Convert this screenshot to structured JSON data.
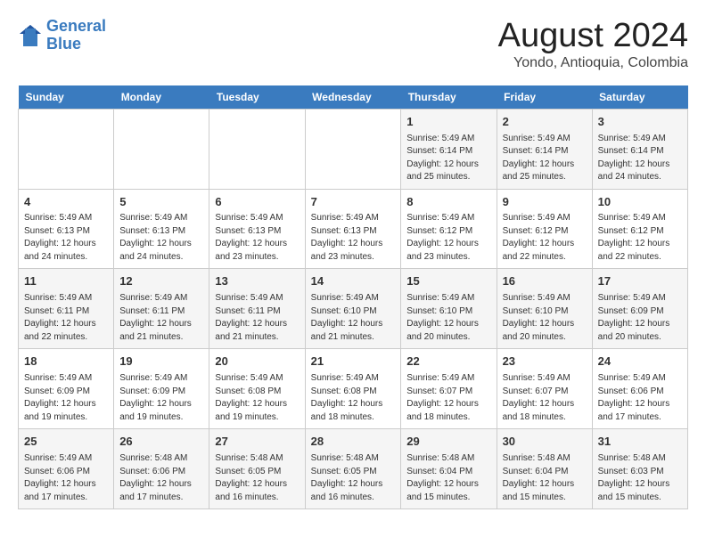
{
  "header": {
    "logo_line1": "General",
    "logo_line2": "Blue",
    "month_year": "August 2024",
    "location": "Yondo, Antioquia, Colombia"
  },
  "days_of_week": [
    "Sunday",
    "Monday",
    "Tuesday",
    "Wednesday",
    "Thursday",
    "Friday",
    "Saturday"
  ],
  "weeks": [
    [
      {
        "num": "",
        "info": ""
      },
      {
        "num": "",
        "info": ""
      },
      {
        "num": "",
        "info": ""
      },
      {
        "num": "",
        "info": ""
      },
      {
        "num": "1",
        "info": "Sunrise: 5:49 AM\nSunset: 6:14 PM\nDaylight: 12 hours\nand 25 minutes."
      },
      {
        "num": "2",
        "info": "Sunrise: 5:49 AM\nSunset: 6:14 PM\nDaylight: 12 hours\nand 25 minutes."
      },
      {
        "num": "3",
        "info": "Sunrise: 5:49 AM\nSunset: 6:14 PM\nDaylight: 12 hours\nand 24 minutes."
      }
    ],
    [
      {
        "num": "4",
        "info": "Sunrise: 5:49 AM\nSunset: 6:13 PM\nDaylight: 12 hours\nand 24 minutes."
      },
      {
        "num": "5",
        "info": "Sunrise: 5:49 AM\nSunset: 6:13 PM\nDaylight: 12 hours\nand 24 minutes."
      },
      {
        "num": "6",
        "info": "Sunrise: 5:49 AM\nSunset: 6:13 PM\nDaylight: 12 hours\nand 23 minutes."
      },
      {
        "num": "7",
        "info": "Sunrise: 5:49 AM\nSunset: 6:13 PM\nDaylight: 12 hours\nand 23 minutes."
      },
      {
        "num": "8",
        "info": "Sunrise: 5:49 AM\nSunset: 6:12 PM\nDaylight: 12 hours\nand 23 minutes."
      },
      {
        "num": "9",
        "info": "Sunrise: 5:49 AM\nSunset: 6:12 PM\nDaylight: 12 hours\nand 22 minutes."
      },
      {
        "num": "10",
        "info": "Sunrise: 5:49 AM\nSunset: 6:12 PM\nDaylight: 12 hours\nand 22 minutes."
      }
    ],
    [
      {
        "num": "11",
        "info": "Sunrise: 5:49 AM\nSunset: 6:11 PM\nDaylight: 12 hours\nand 22 minutes."
      },
      {
        "num": "12",
        "info": "Sunrise: 5:49 AM\nSunset: 6:11 PM\nDaylight: 12 hours\nand 21 minutes."
      },
      {
        "num": "13",
        "info": "Sunrise: 5:49 AM\nSunset: 6:11 PM\nDaylight: 12 hours\nand 21 minutes."
      },
      {
        "num": "14",
        "info": "Sunrise: 5:49 AM\nSunset: 6:10 PM\nDaylight: 12 hours\nand 21 minutes."
      },
      {
        "num": "15",
        "info": "Sunrise: 5:49 AM\nSunset: 6:10 PM\nDaylight: 12 hours\nand 20 minutes."
      },
      {
        "num": "16",
        "info": "Sunrise: 5:49 AM\nSunset: 6:10 PM\nDaylight: 12 hours\nand 20 minutes."
      },
      {
        "num": "17",
        "info": "Sunrise: 5:49 AM\nSunset: 6:09 PM\nDaylight: 12 hours\nand 20 minutes."
      }
    ],
    [
      {
        "num": "18",
        "info": "Sunrise: 5:49 AM\nSunset: 6:09 PM\nDaylight: 12 hours\nand 19 minutes."
      },
      {
        "num": "19",
        "info": "Sunrise: 5:49 AM\nSunset: 6:09 PM\nDaylight: 12 hours\nand 19 minutes."
      },
      {
        "num": "20",
        "info": "Sunrise: 5:49 AM\nSunset: 6:08 PM\nDaylight: 12 hours\nand 19 minutes."
      },
      {
        "num": "21",
        "info": "Sunrise: 5:49 AM\nSunset: 6:08 PM\nDaylight: 12 hours\nand 18 minutes."
      },
      {
        "num": "22",
        "info": "Sunrise: 5:49 AM\nSunset: 6:07 PM\nDaylight: 12 hours\nand 18 minutes."
      },
      {
        "num": "23",
        "info": "Sunrise: 5:49 AM\nSunset: 6:07 PM\nDaylight: 12 hours\nand 18 minutes."
      },
      {
        "num": "24",
        "info": "Sunrise: 5:49 AM\nSunset: 6:06 PM\nDaylight: 12 hours\nand 17 minutes."
      }
    ],
    [
      {
        "num": "25",
        "info": "Sunrise: 5:49 AM\nSunset: 6:06 PM\nDaylight: 12 hours\nand 17 minutes."
      },
      {
        "num": "26",
        "info": "Sunrise: 5:48 AM\nSunset: 6:06 PM\nDaylight: 12 hours\nand 17 minutes."
      },
      {
        "num": "27",
        "info": "Sunrise: 5:48 AM\nSunset: 6:05 PM\nDaylight: 12 hours\nand 16 minutes."
      },
      {
        "num": "28",
        "info": "Sunrise: 5:48 AM\nSunset: 6:05 PM\nDaylight: 12 hours\nand 16 minutes."
      },
      {
        "num": "29",
        "info": "Sunrise: 5:48 AM\nSunset: 6:04 PM\nDaylight: 12 hours\nand 15 minutes."
      },
      {
        "num": "30",
        "info": "Sunrise: 5:48 AM\nSunset: 6:04 PM\nDaylight: 12 hours\nand 15 minutes."
      },
      {
        "num": "31",
        "info": "Sunrise: 5:48 AM\nSunset: 6:03 PM\nDaylight: 12 hours\nand 15 minutes."
      }
    ]
  ]
}
